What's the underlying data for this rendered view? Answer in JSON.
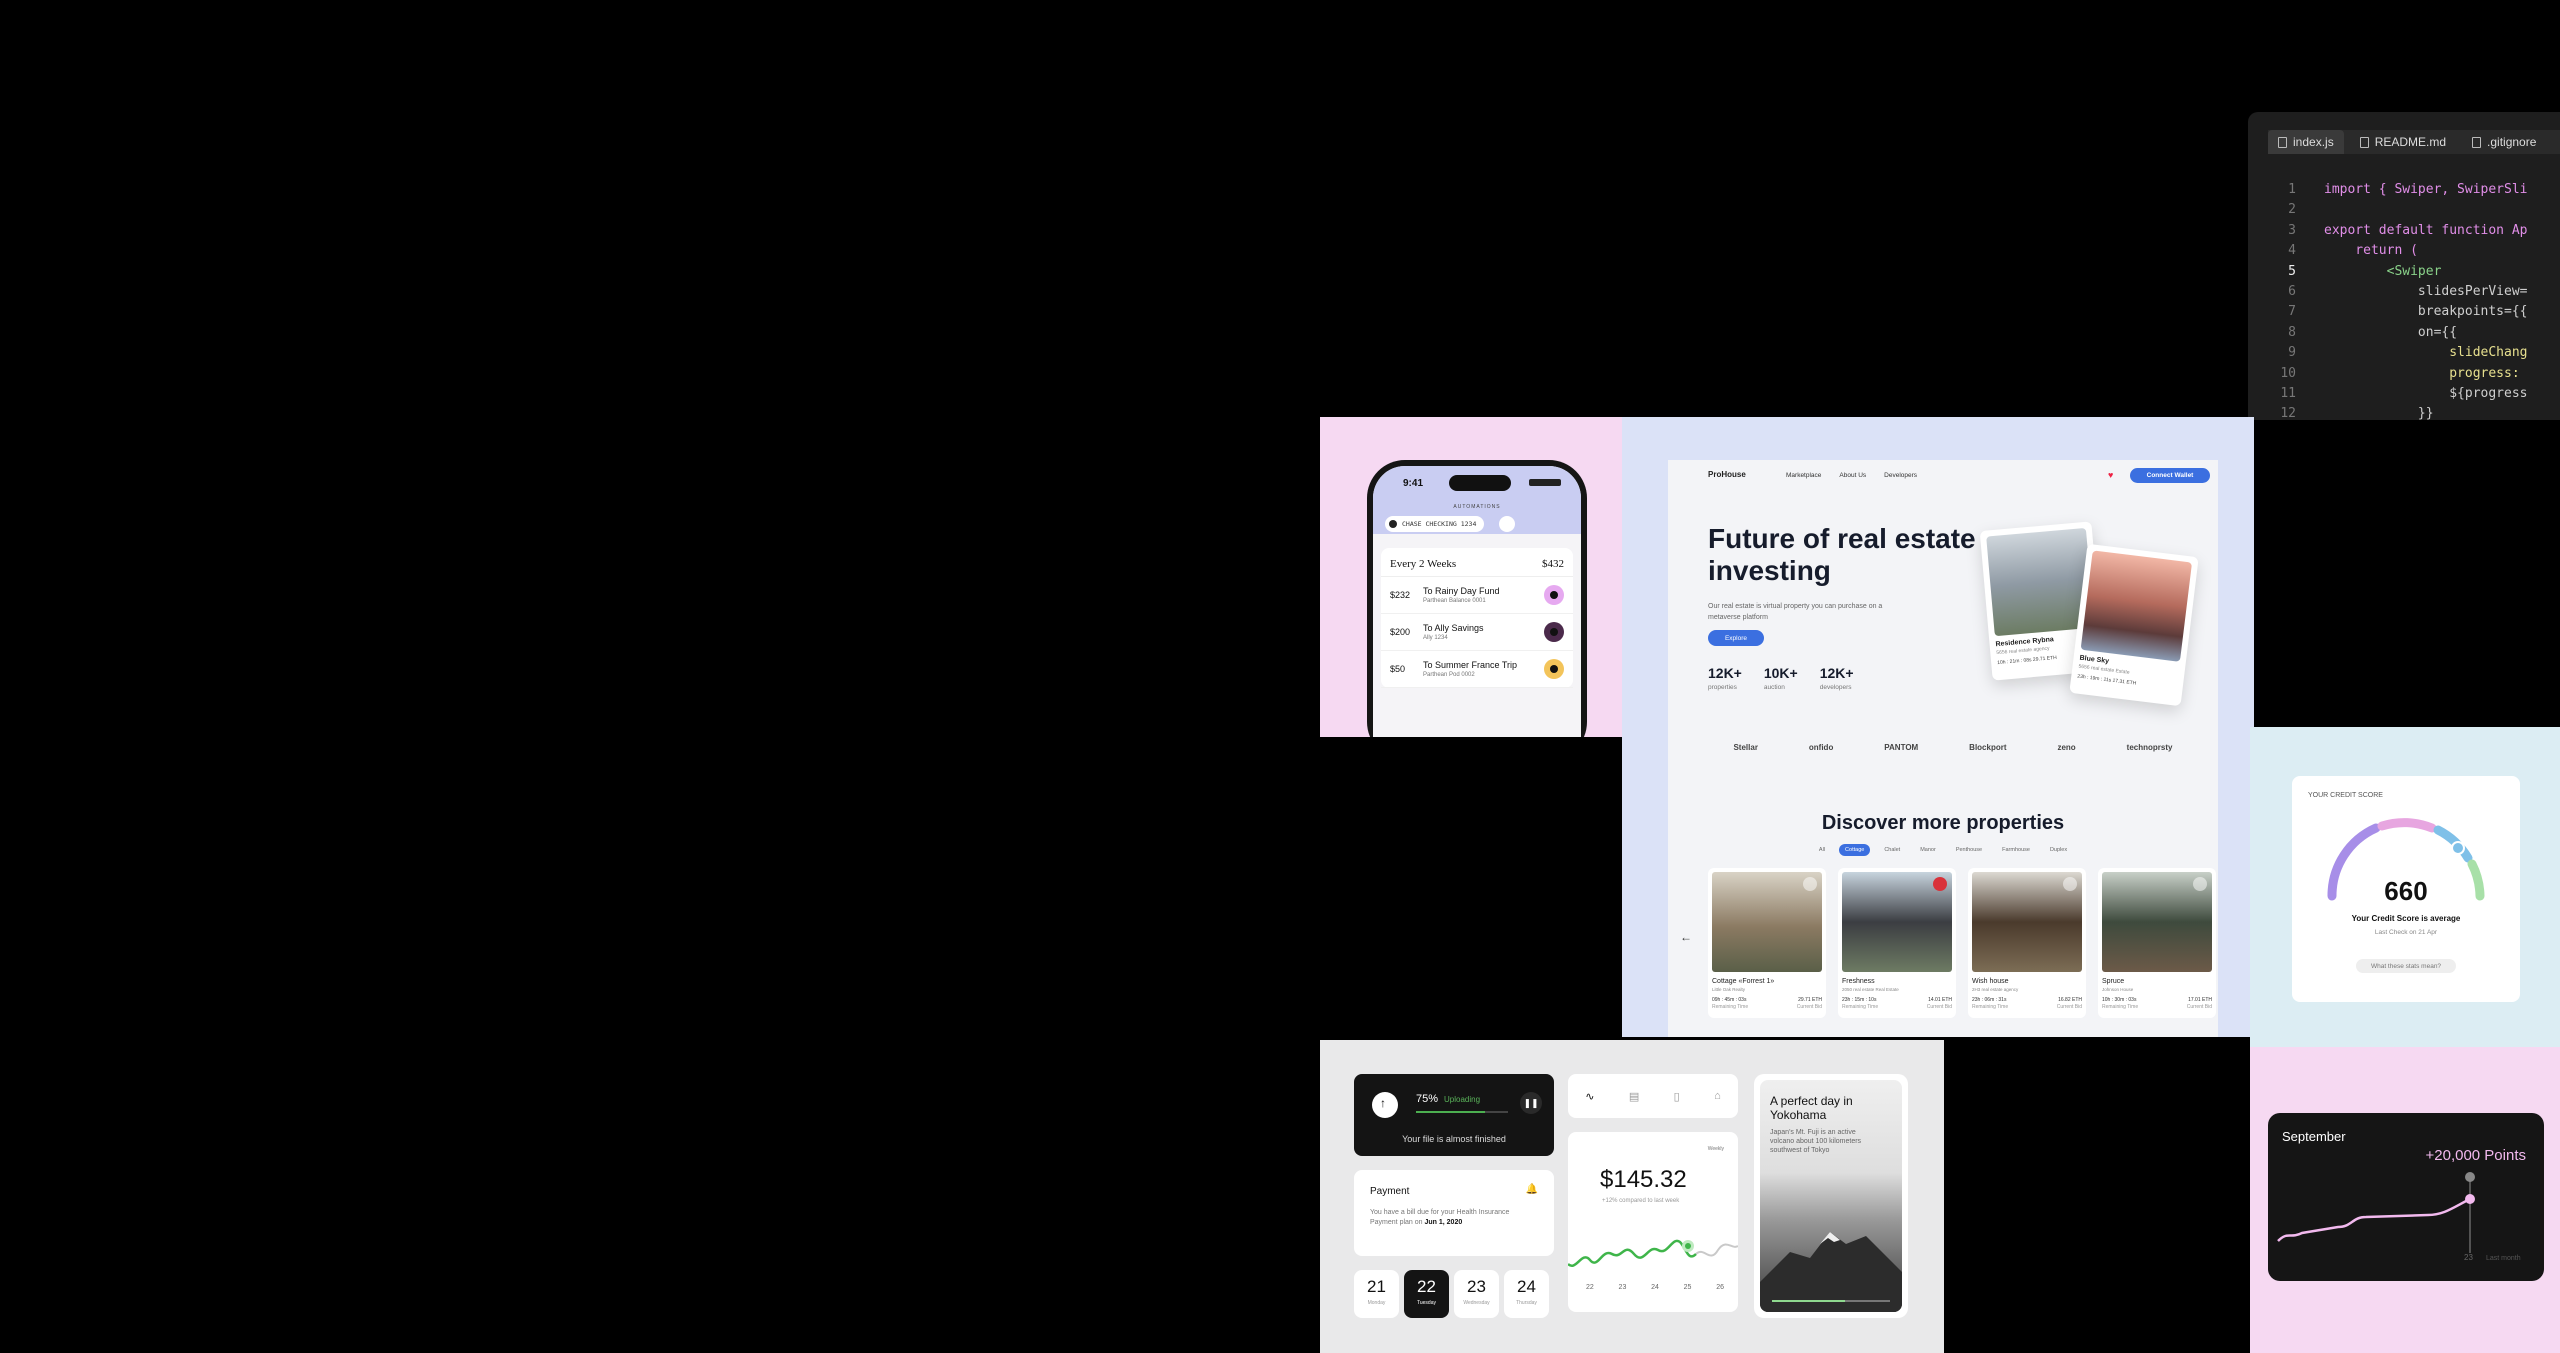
{
  "code_editor": {
    "tabs": [
      "index.js",
      "README.md",
      ".gitignore"
    ],
    "lines": [
      {
        "n": "1",
        "code": "import { Swiper, SwiperSli"
      },
      {
        "n": "2",
        "code": ""
      },
      {
        "n": "3",
        "code": "export default function Ap"
      },
      {
        "n": "4",
        "code": "    return ("
      },
      {
        "n": "5",
        "code": "        <Swiper"
      },
      {
        "n": "6",
        "code": "            slidesPerView="
      },
      {
        "n": "7",
        "code": "            breakpoints={{"
      },
      {
        "n": "8",
        "code": "            on={{"
      },
      {
        "n": "9",
        "code": "                slideChang"
      },
      {
        "n": "10",
        "code": "                progress:"
      },
      {
        "n": "11",
        "code": "                ${progress"
      },
      {
        "n": "12",
        "code": "            }}"
      }
    ]
  },
  "phone": {
    "time": "9:41",
    "screen_label": "AUTOMATIONS",
    "account": "CHASE CHECKING 1234",
    "schedule": "Every 2 Weeks",
    "total": "$432",
    "rows": [
      {
        "amount": "$232",
        "title": "To Rainy Day Fund",
        "sub": "Parthean Balance 0001",
        "color": "#e6a9f0"
      },
      {
        "amount": "$200",
        "title": "To Ally Savings",
        "sub": "Ally 1234",
        "color": "#4b2a4b"
      },
      {
        "amount": "$50",
        "title": "To Summer France Trip",
        "sub": "Parthean Pod 0002",
        "color": "#f3c45a"
      }
    ]
  },
  "real_estate": {
    "brand": "ProHouse",
    "nav": [
      "Marketplace",
      "About Us",
      "Developers"
    ],
    "connect": "Connect Wallet",
    "title": "Future of real estate investing",
    "subtitle": "Our real estate is virtual property you can purchase on a metaverse platform",
    "explore": "Explore",
    "stats": [
      {
        "value": "12K+",
        "label": "properties"
      },
      {
        "value": "10K+",
        "label": "auction"
      },
      {
        "value": "12K+",
        "label": "developers"
      }
    ],
    "hero_cards": [
      {
        "name": "Residence Rybna",
        "sub": "5656 real estate agency",
        "meta": "10h : 21m : 08s   29.71 ETH"
      },
      {
        "name": "Blue Sky",
        "sub": "5656 real estate Estate",
        "meta": "23h : 19m : 11s   17.31 ETH"
      }
    ],
    "partners": [
      "Stellar",
      "onfido",
      "PANTOM",
      "Blockport",
      "zeno",
      "technoprsty"
    ],
    "discover": "Discover more properties",
    "filters": [
      "All",
      "Cottage",
      "Chalet",
      "Manor",
      "Penthouse",
      "Farmhouse",
      "Duplex"
    ],
    "properties": [
      {
        "name": "Cottage «Forrest 1»",
        "sub": "Little Oak Realty",
        "time": "09h : 45m : 03s",
        "price": "29.71 ETH",
        "t_label": "Remaining Time",
        "p_label": "Current Bid"
      },
      {
        "name": "Freshness",
        "sub": "2050 real estate Real Estate",
        "time": "23h : 15m : 10s",
        "price": "14.01 ETH",
        "t_label": "Remaining Time",
        "p_label": "Current Bid"
      },
      {
        "name": "Wish house",
        "sub": "2H3 real estate agency",
        "time": "23h : 06m : 31s",
        "price": "16.82 ETH",
        "t_label": "Remaining Time",
        "p_label": "Current Bid"
      },
      {
        "name": "Spruce",
        "sub": "Johnson House",
        "time": "10h : 30m : 03s",
        "price": "17.01 ETH",
        "t_label": "Remaining Time",
        "p_label": "Current Bid"
      }
    ]
  },
  "credit": {
    "label": "YOUR CREDIT SCORE",
    "score": "660",
    "status": "Your Credit Score is average",
    "last_check": "Last Check on 21 Apr",
    "button": "What these stats mean?"
  },
  "widgets": {
    "upload_percent": "75%",
    "upload_label": "Uploading",
    "upload_progress": 0.75,
    "upload_message": "Your file is almost finished",
    "payment_title": "Payment",
    "payment_text_a": "You have a bill due for your Health Insurance Payment plan on ",
    "payment_date": "Jun 1, 2020",
    "days": [
      {
        "d": "21",
        "w": "Monday"
      },
      {
        "d": "22",
        "w": "Tuesday"
      },
      {
        "d": "23",
        "w": "Wednesday"
      },
      {
        "d": "24",
        "w": "Thursday"
      }
    ],
    "balance": "$145.32",
    "balance_sub": "+12% compared to last week",
    "period": "Weekly",
    "x_labels": [
      "22",
      "23",
      "24",
      "25",
      "26"
    ],
    "trip_title": "A perfect day in Yokohama",
    "trip_desc": "Japan's Mt. Fuji is an active volcano about 100 kilometers southwest of Tokyo"
  },
  "points": {
    "month": "September",
    "points": "+20,000 Points",
    "day": "23",
    "caption": "Last month"
  }
}
